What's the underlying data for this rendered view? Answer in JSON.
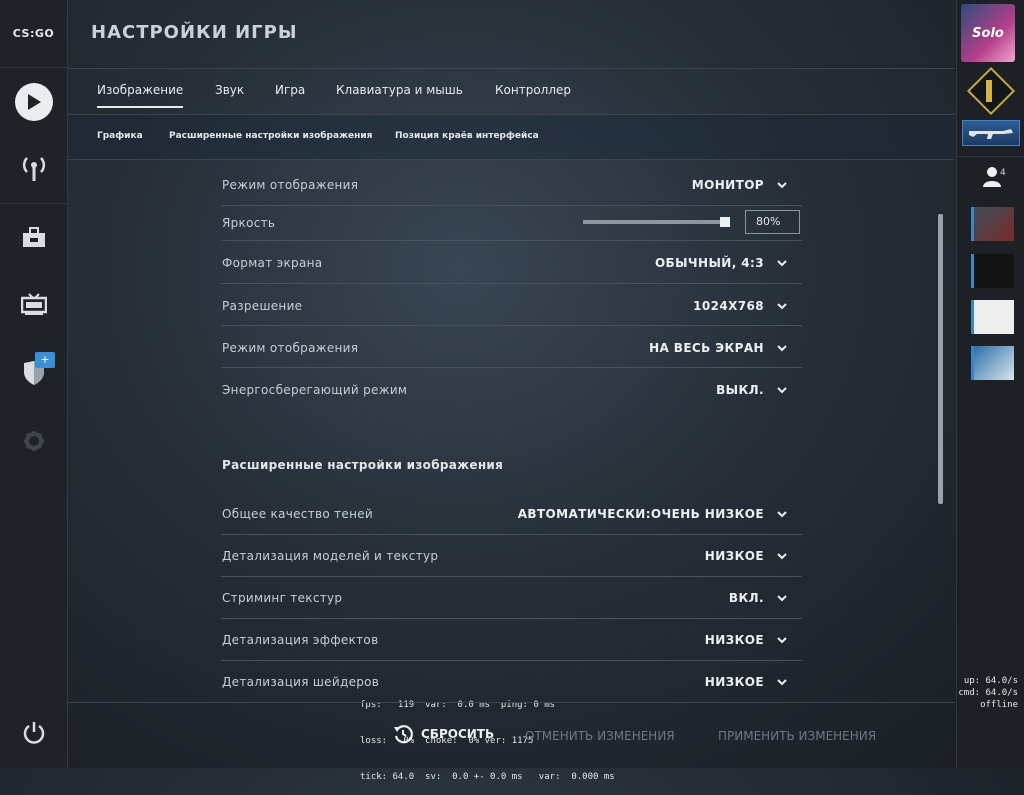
{
  "app": {
    "logo": "CS:GO"
  },
  "header": {
    "title": "НАСТРОЙКИ ИГРЫ"
  },
  "tabs": [
    {
      "label": "Изображение",
      "active": true
    },
    {
      "label": "Звук"
    },
    {
      "label": "Игра"
    },
    {
      "label": "Клавиатура и мышь"
    },
    {
      "label": "Контроллер"
    }
  ],
  "subtabs": [
    {
      "label": "Графика"
    },
    {
      "label": "Расширенные настройки изображения"
    },
    {
      "label": "Позиция краёв интерфейса"
    }
  ],
  "settings": [
    {
      "label": "Режим отображения",
      "value": "МОНИТОР"
    },
    {
      "label": "Яркость",
      "value": "80%"
    },
    {
      "label": "Формат экрана",
      "value": "ОБЫЧНЫЙ, 4:3"
    },
    {
      "label": "Разрешение",
      "value": "1024X768"
    },
    {
      "label": "Режим отображения",
      "value": "НА ВЕСЬ ЭКРАН"
    },
    {
      "label": "Энергосберегающий режим",
      "value": "ВЫКЛ."
    }
  ],
  "brightness_level": 0.8,
  "advanced": {
    "title": "Расширенные настройки изображения",
    "rows": [
      {
        "label": "Общее качество теней",
        "value": "АВТОМАТИЧЕСКИ:ОЧЕНЬ НИЗКОЕ"
      },
      {
        "label": "Детализация моделей и текстур",
        "value": "НИЗКОЕ"
      },
      {
        "label": "Стриминг текстур",
        "value": "ВКЛ."
      },
      {
        "label": "Детализация эффектов",
        "value": "НИЗКОЕ"
      },
      {
        "label": "Детализация шейдеров",
        "value": "НИЗКОЕ"
      }
    ]
  },
  "netgraph": {
    "lines": [
      "fps:   119  var:  0.0 ms  ping: 0 ms",
      "loss:   0%  choke:  0% ver: 1175",
      "tick: 64.0  sv:  0.0 +- 0.0 ms   var:  0.000 ms"
    ],
    "right": [
      "up: 64.0/s",
      "cmd: 64.0/s",
      "offline"
    ]
  },
  "friends": {
    "count": "4"
  },
  "profile": {
    "avatar_text": "Solo"
  },
  "footer": {
    "reset": "СБРОСИТЬ",
    "cancel": "ОТМЕНИТЬ ИЗМЕНЕНИЯ",
    "apply": "ПРИМЕНИТЬ ИЗМЕНЕНИЯ"
  },
  "icons": {
    "play": "play-icon",
    "broadcast": "broadcast-icon",
    "inventory": "briefcase-icon",
    "watch": "tv-icon",
    "shield": "shield-icon",
    "settings": "gear-icon",
    "power": "power-icon",
    "reset": "reset-icon",
    "chevron": "chevron-down-icon",
    "friends": "person-icon"
  }
}
